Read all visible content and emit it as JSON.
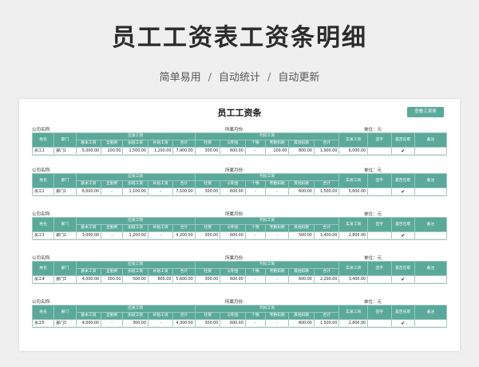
{
  "page": {
    "title": "员工工资表工资条明细",
    "subtitle_parts": [
      "简单易用",
      "自动统计",
      "自动更新"
    ],
    "subtitle_sep": "/"
  },
  "sheet": {
    "title": "员工工资条",
    "button_label": "查看工资表"
  },
  "labels": {
    "company": "公司名称:",
    "month": "所属月份:",
    "unit": "单位：元"
  },
  "headers": {
    "name": "姓名",
    "dept": "部门",
    "payable_group": "应发工资",
    "deduct_group": "代扣工资",
    "actual": "实发工资",
    "sign": "签字",
    "employed": "是否在职",
    "note": "备注",
    "payable": [
      "基本工资",
      "全勤奖",
      "加班工资",
      "补贴工资",
      "合计"
    ],
    "deduct": [
      "社保",
      "公积金",
      "个税",
      "考勤扣款",
      "其他扣款",
      "合计"
    ]
  },
  "colors": {
    "header_bg": "#5aa99a",
    "border": "#9cc9bf",
    "accent": "#5aa99a"
  },
  "rows": [
    {
      "name": "员工1",
      "dept": "部门1",
      "cells": [
        "5,000.00",
        "200.00",
        "1,500.00",
        "1,200.00",
        "7,900.00",
        "300.00",
        "600.00",
        "-",
        "200.00",
        "800.00",
        "1,900.00",
        "6,000.00",
        "",
        "✔",
        ""
      ]
    },
    {
      "name": "员工2",
      "dept": "部门1",
      "cells": [
        "6,000.00",
        "-",
        "1,100.00",
        "-",
        "7,100.00",
        "300.00",
        "600.00",
        "-",
        "-",
        "600.00",
        "1,500.00",
        "5,600.00",
        "",
        "✔",
        ""
      ]
    },
    {
      "name": "员工3",
      "dept": "部门2",
      "cells": [
        "3,000.00",
        "-",
        "1,200.00",
        "-",
        "4,200.00",
        "300.00",
        "600.00",
        "-",
        "-",
        "500.00",
        "1,400.00",
        "2,800.00",
        "",
        "✔",
        ""
      ]
    },
    {
      "name": "员工4",
      "dept": "部门3",
      "cells": [
        "4,000.00",
        "300.00",
        "500.00",
        "800.00",
        "5,600.00",
        "300.00",
        "600.00",
        "-",
        "-",
        "600.00",
        "2,200.00",
        "3,400.00",
        "",
        "✔",
        ""
      ]
    },
    {
      "name": "员工5",
      "dept": "部门3",
      "cells": [
        "4,000.00",
        "-",
        "300.00",
        "-",
        "4,300.00",
        "300.00",
        "600.00",
        "-",
        "-",
        "600.00",
        "1,500.00",
        "2,800.00",
        "",
        "✔",
        ""
      ]
    }
  ]
}
